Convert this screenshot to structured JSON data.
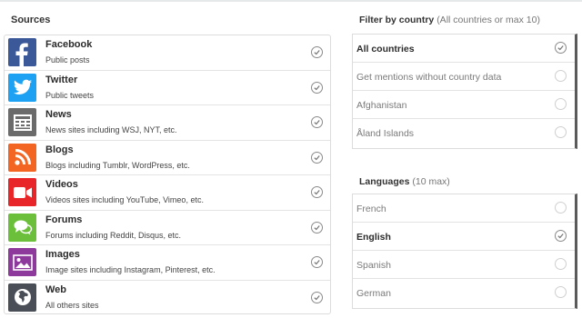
{
  "sources": {
    "title": "Sources",
    "items": [
      {
        "name": "Facebook",
        "desc": "Public posts",
        "icon": "facebook-icon",
        "color": "#3b5998",
        "checked": true
      },
      {
        "name": "Twitter",
        "desc": "Public tweets",
        "icon": "twitter-icon",
        "color": "#1da1f2",
        "checked": true
      },
      {
        "name": "News",
        "desc": "News sites including WSJ, NYT, etc.",
        "icon": "news-icon",
        "color": "#6b6b6b",
        "checked": true
      },
      {
        "name": "Blogs",
        "desc": "Blogs including Tumblr, WordPress, etc.",
        "icon": "rss-icon",
        "color": "#f26522",
        "checked": true
      },
      {
        "name": "Videos",
        "desc": "Videos sites including YouTube, Vimeo, etc.",
        "icon": "video-camera-icon",
        "color": "#e8262a",
        "checked": true
      },
      {
        "name": "Forums",
        "desc": "Forums including Reddit, Disqus, etc.",
        "icon": "chat-bubbles-icon",
        "color": "#6cbf3a",
        "checked": true
      },
      {
        "name": "Images",
        "desc": "Image sites including Instagram, Pinterest, etc.",
        "icon": "image-icon",
        "color": "#8e3a9d",
        "checked": true
      },
      {
        "name": "Web",
        "desc": "All others sites",
        "icon": "globe-icon",
        "color": "#4a4f57",
        "checked": true
      }
    ]
  },
  "country_filter": {
    "title": "Filter by country",
    "hint": "(All countries or max 10)",
    "options": [
      {
        "label": "All countries",
        "selected": true
      },
      {
        "label": "Get mentions without country data",
        "selected": false
      },
      {
        "label": "Afghanistan",
        "selected": false
      },
      {
        "label": "Åland Islands",
        "selected": false
      }
    ]
  },
  "languages": {
    "title": "Languages",
    "hint": "(10 max)",
    "options": [
      {
        "label": "French",
        "selected": false
      },
      {
        "label": "English",
        "selected": true
      },
      {
        "label": "Spanish",
        "selected": false
      },
      {
        "label": "German",
        "selected": false
      }
    ]
  }
}
